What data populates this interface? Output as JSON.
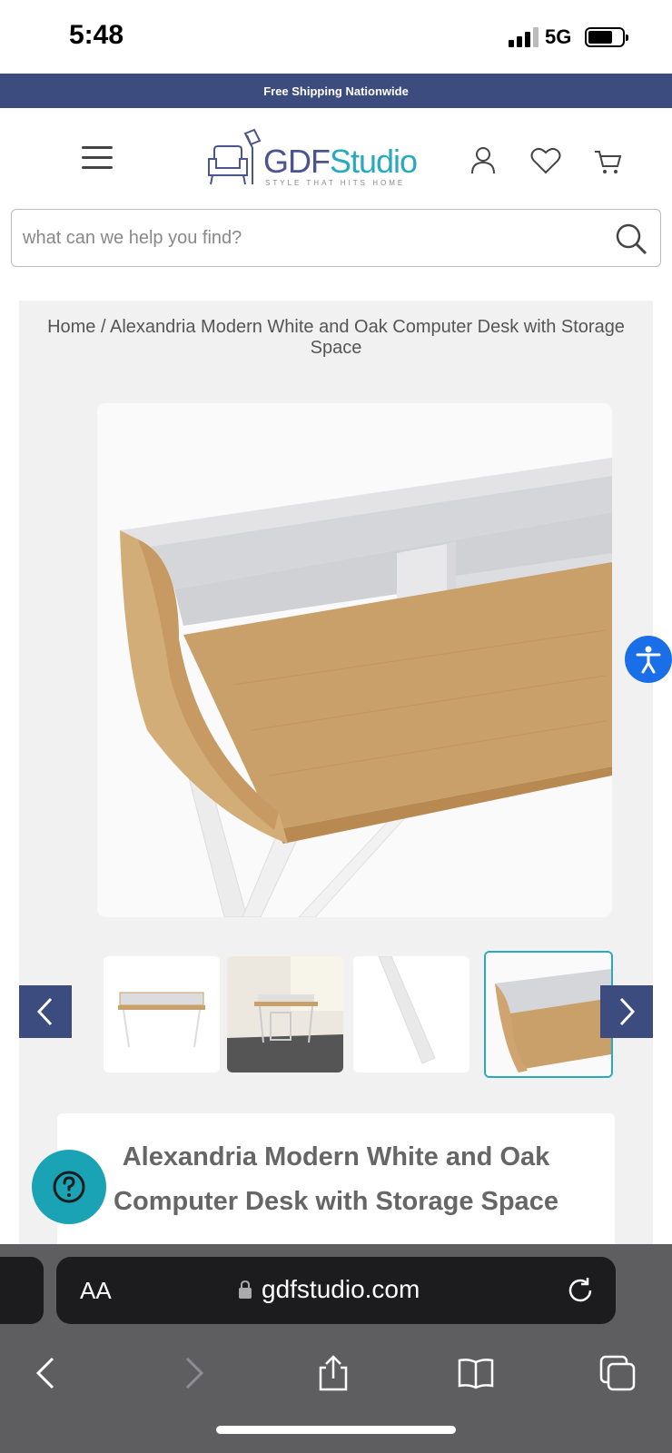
{
  "status": {
    "time": "5:48",
    "network": "5G"
  },
  "promo": {
    "text": "Free Shipping Nationwide"
  },
  "header": {
    "logo_part1": "GDF",
    "logo_part2": "Studio",
    "tagline": "STYLE THAT HITS HOME",
    "icons": [
      "menu-icon",
      "account-icon",
      "heart-icon",
      "cart-icon"
    ]
  },
  "search": {
    "placeholder": "what can we help you find?"
  },
  "breadcrumb": {
    "home": "Home",
    "separator": "/",
    "current": "Alexandria Modern White and Oak Computer Desk with Storage Space"
  },
  "product": {
    "title": "Alexandria Modern White and Oak Computer Desk with Storage Space",
    "thumbnails": 4,
    "active_thumbnail": 4
  },
  "browser": {
    "text_size": "AA",
    "url": "gdfstudio.com"
  },
  "colors": {
    "brand_navy": "#3d4c7f",
    "brand_teal": "#27aabf",
    "accessibility_blue": "#1a6ee8",
    "help_teal": "#1aa3b4",
    "oak": "#c99f6a"
  }
}
